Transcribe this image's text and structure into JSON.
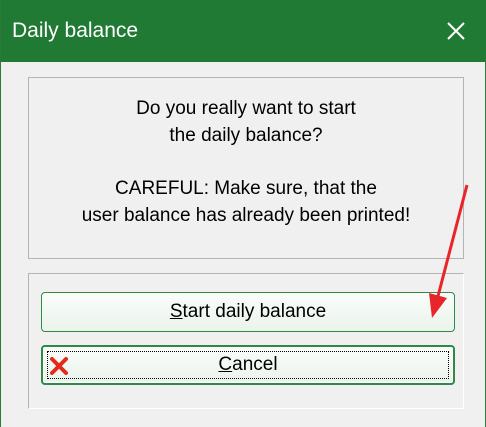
{
  "window": {
    "title": "Daily balance",
    "close_label": "✕",
    "accent_color": "#217a34"
  },
  "message": {
    "line1": "Do you really want to start",
    "line2": "the daily balance?",
    "line3": "CAREFUL: Make sure, that the",
    "line4": "user balance has already been printed!"
  },
  "buttons": {
    "start_mnemonic": "S",
    "start_rest": "tart daily balance",
    "cancel_mnemonic": "C",
    "cancel_rest": "ancel",
    "cancel_icon": "red-x-icon"
  },
  "annotation": {
    "arrow_color": "#e8252a"
  }
}
